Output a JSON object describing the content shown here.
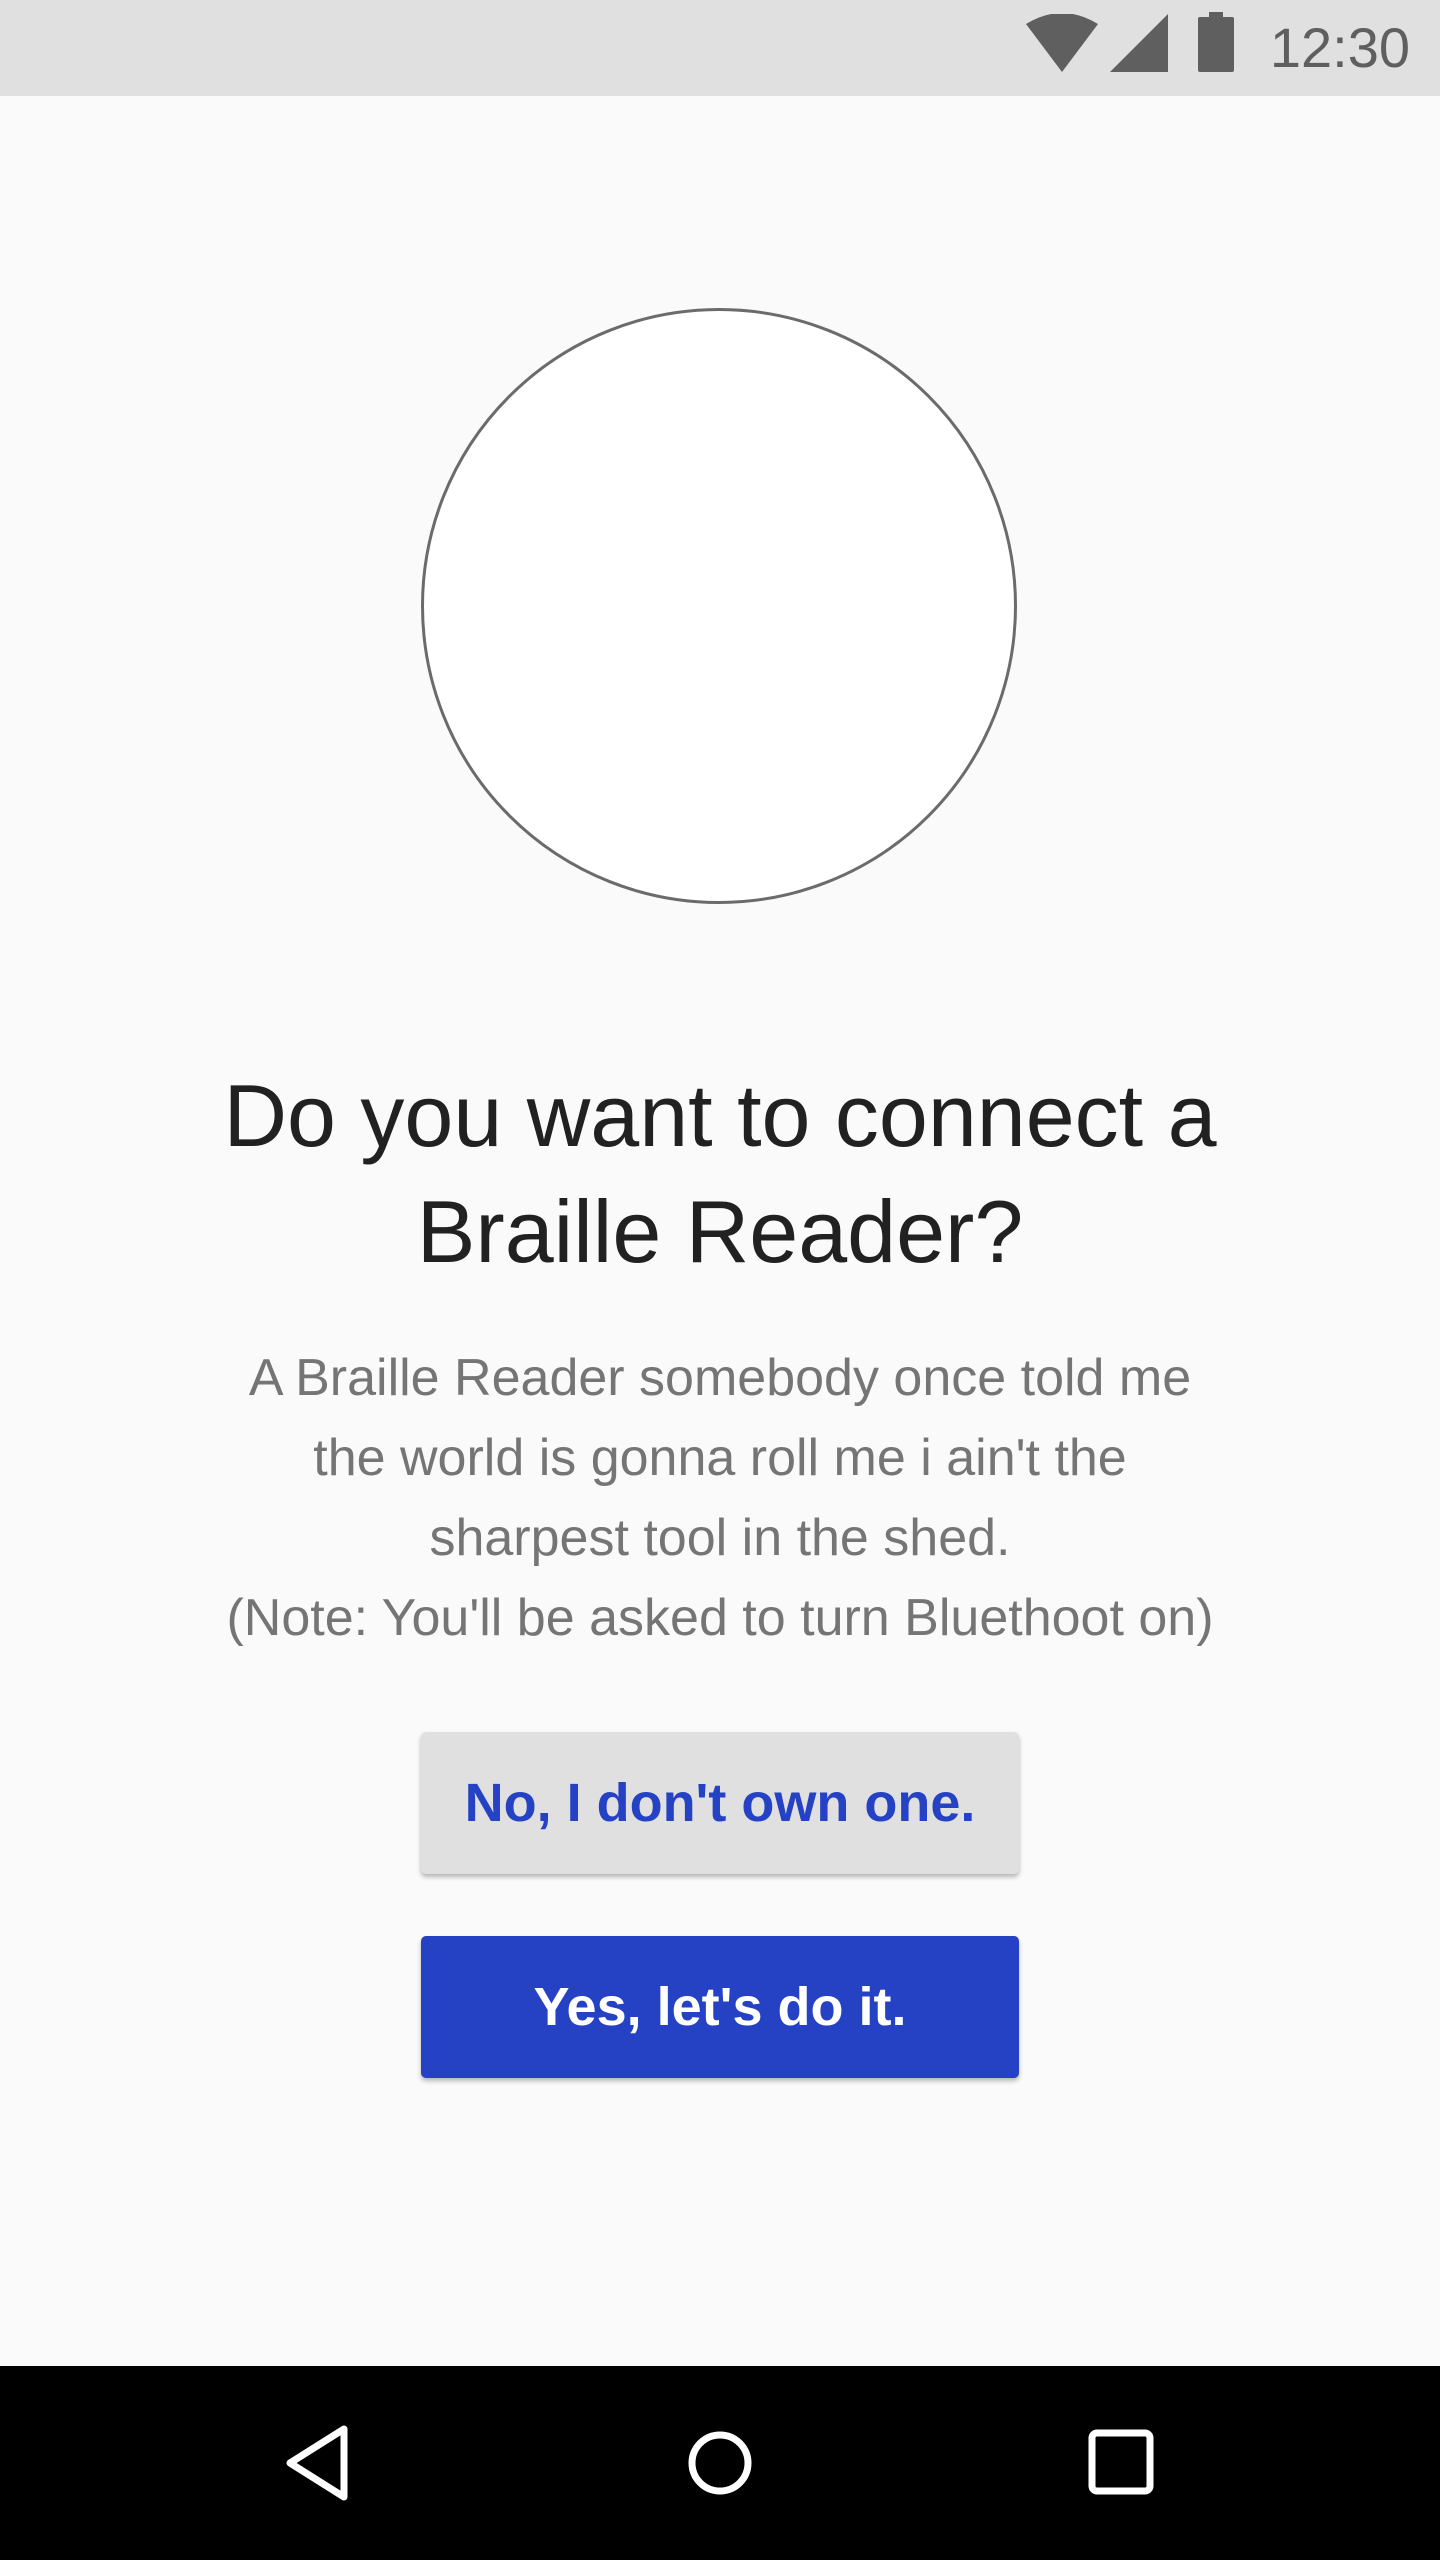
{
  "status_bar": {
    "time": "12:30",
    "icons": [
      "wifi-icon",
      "cell-signal-icon",
      "battery-icon"
    ]
  },
  "main": {
    "illustration": "circle-placeholder",
    "title": "Do you want to connect a Braille Reader?",
    "description_lines": [
      "A Braille Reader somebody once told me",
      "the world is gonna roll me i ain't the",
      "sharpest tool in the shed.",
      "(Note: You'll be asked to turn Bluethoot on)"
    ],
    "no_button_label": "No, I don't own one.",
    "yes_button_label": "Yes, let's do it."
  },
  "nav_bar": {
    "icons": [
      "back-icon",
      "home-icon",
      "recents-icon"
    ]
  },
  "colors": {
    "accent": "#2541c4",
    "status_bar_bg": "#e0e0e0",
    "page_bg": "#fafafa",
    "title_text": "#212121",
    "body_text": "#757575"
  }
}
